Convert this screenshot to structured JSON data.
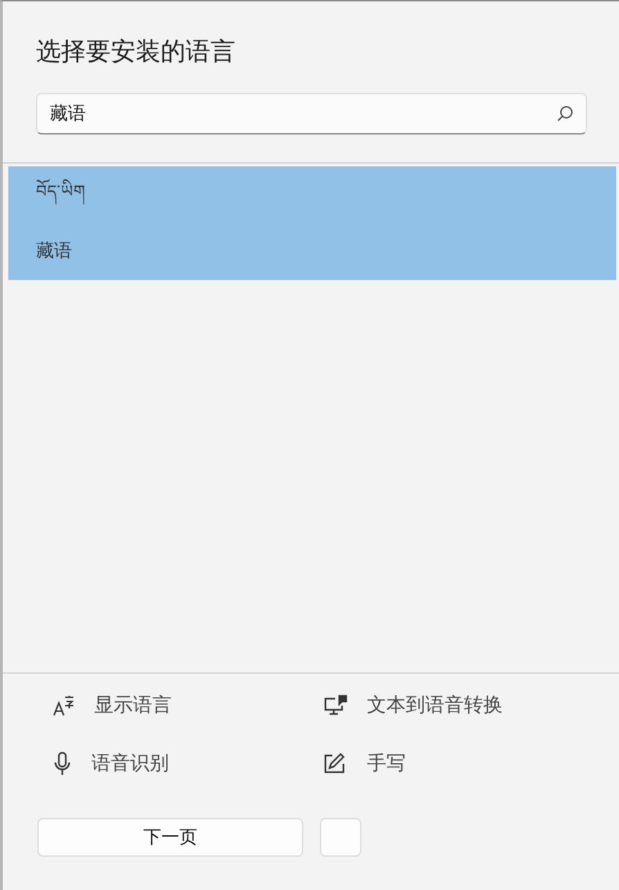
{
  "title": "选择要安装的语言",
  "search": {
    "value": "藏语"
  },
  "languages": [
    {
      "native": "བོད་ཡིག",
      "name": "藏语",
      "selected": true
    }
  ],
  "features": [
    {
      "label": "显示语言"
    },
    {
      "label": "文本到语音转换"
    },
    {
      "label": "语音识别"
    },
    {
      "label": "手写"
    }
  ],
  "buttons": [
    {
      "label": "下一页",
      "kind": "primary"
    },
    {
      "kind": "secondary"
    }
  ]
}
